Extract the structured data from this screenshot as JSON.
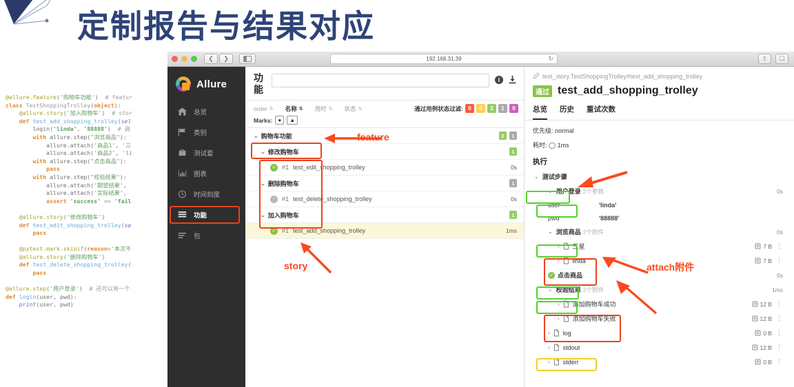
{
  "slide": {
    "title": "定制报告与结果对应"
  },
  "code": {
    "lines": [
      "@allure.feature('购物车功能')  # featur",
      "class TestShoppingTrolley(object):",
      "    @allure.story('加入购物车')  # stor",
      "    def test_add_shopping_trolley(sel",
      "        login('linda', '88888')  # 调",
      "        with allure.step(\"浏览商品\"):",
      "            allure.attach('商品1', '三",
      "            allure.attach('商品2', 'li",
      "        with allure.step(\"点击商品\"):",
      "            pass",
      "        with allure.step(\"校验结果\"):",
      "            allure.attach('期望结果',",
      "            allure.attach('实际结果',",
      "            assert 'success' == 'fail",
      "",
      "    @allure.story('修改购物车')",
      "    def test_edit_shopping_trolley(se",
      "        pass",
      "",
      "    @pytest.mark.skipif(reason='本次不",
      "    @allure.story('删除购物车')",
      "    def test_delete_shopping_trolley(",
      "        pass",
      "",
      "@allure.step('用户登录')  # 还可以将一个",
      "def login(user, pwd):",
      "    print(user, pwd)"
    ]
  },
  "browser": {
    "url": "192.168.31.39",
    "back_icon": "chevron-left-icon",
    "forward_icon": "chevron-right-icon",
    "sidebar_toggle_icon": "sidebar-toggle-icon",
    "reload_icon": "reload-icon",
    "share_icon": "share-icon",
    "tabs_icon": "new-tab-icon"
  },
  "allure_nav": {
    "brand": "Allure",
    "items": [
      {
        "label": "总览",
        "icon": "home-icon",
        "active": false
      },
      {
        "label": "类别",
        "icon": "flag-icon",
        "active": false
      },
      {
        "label": "测试套",
        "icon": "briefcase-icon",
        "active": false
      },
      {
        "label": "图表",
        "icon": "bar-chart-icon",
        "active": false
      },
      {
        "label": "时间刻度",
        "icon": "clock-icon",
        "active": false
      },
      {
        "label": "功能",
        "icon": "list-icon",
        "active": true
      },
      {
        "label": "包",
        "icon": "lines-icon",
        "active": false
      }
    ]
  },
  "mid_panel": {
    "title": "功能",
    "search_placeholder": "",
    "search_value": "",
    "info_icon": "info-icon",
    "download_icon": "download-icon",
    "sort_columns": [
      {
        "label": "order",
        "bold": false
      },
      {
        "label": "名称",
        "bold": true
      },
      {
        "label": "用时",
        "bold": false
      },
      {
        "label": "状态",
        "bold": false
      }
    ],
    "filter_label": "通过用例状态过滤:",
    "filter_badges": [
      {
        "value": "0",
        "color": "#fd5a3e"
      },
      {
        "value": "0",
        "color": "#ffd050"
      },
      {
        "value": "2",
        "color": "#97cc64"
      },
      {
        "value": "1",
        "color": "#aaaaaa"
      },
      {
        "value": "0",
        "color": "#d35ebe"
      }
    ],
    "marks_label": "Marks:",
    "marks": [
      "bug-icon",
      "warning-icon"
    ],
    "tree": [
      {
        "level": "feature",
        "label": "购物车功能",
        "chevron": "⌄",
        "badges": [
          {
            "value": "2",
            "color": "#97cc64"
          },
          {
            "value": "1",
            "color": "#aaaaaa"
          }
        ],
        "duration": ""
      },
      {
        "level": "story",
        "label": "修改购物车",
        "chevron": "⌄",
        "badges": [
          {
            "value": "1",
            "color": "#97cc64"
          }
        ],
        "duration": ""
      },
      {
        "level": "case",
        "label": "test_edit_shopping_trolley",
        "num": "#1",
        "status": "pass",
        "duration": "0s",
        "badges": []
      },
      {
        "level": "story",
        "label": "删除购物车",
        "chevron": "⌄",
        "badges": [
          {
            "value": "1",
            "color": "#aaaaaa"
          }
        ],
        "duration": ""
      },
      {
        "level": "case",
        "label": "test_delete_shopping_trolley",
        "num": "#1",
        "status": "skip",
        "duration": "0s",
        "badges": []
      },
      {
        "level": "story",
        "label": "加入购物车",
        "chevron": "⌄",
        "badges": [
          {
            "value": "1",
            "color": "#97cc64"
          }
        ],
        "duration": ""
      },
      {
        "level": "case",
        "label": "test_add_shopping_trolley",
        "num": "#1",
        "status": "pass",
        "duration": "1ms",
        "selected": true,
        "badges": []
      }
    ]
  },
  "right_panel": {
    "breadcrumb": "test_story.TestShoppingTrolley#test_add_shopping_trolley",
    "status_chip": "通过",
    "title": "test_add_shopping_trolley",
    "tabs": [
      {
        "label": "总览",
        "active": true
      },
      {
        "label": "历史",
        "active": false
      },
      {
        "label": "重试次数",
        "active": false
      }
    ],
    "severity_label": "优先级:",
    "severity_value": "normal",
    "duration_label": "耗时:",
    "duration_value": "1ms",
    "execution_label": "执行",
    "steps_label": "测试步骤",
    "steps": [
      {
        "name": "用户登录",
        "count": "2个参数",
        "level": 2,
        "chevron": "⌄",
        "duration": "0s",
        "highlight": "green",
        "params": [
          {
            "key": "user",
            "value": "'linda'"
          },
          {
            "key": "pwd",
            "value": "'88888'"
          }
        ],
        "attachments": []
      },
      {
        "name": "浏览商品",
        "count": "2个附件",
        "level": 2,
        "chevron": "⌄",
        "duration": "0s",
        "highlight": "green",
        "params": [],
        "attachments": [
          {
            "name": "三星",
            "size": "7 B"
          },
          {
            "name": "linda",
            "size": "7 B"
          }
        ]
      },
      {
        "name": "点击商品",
        "count": "",
        "level": 2,
        "chevron": "check",
        "duration": "0s",
        "highlight": "green",
        "params": [],
        "attachments": []
      },
      {
        "name": "校验结果",
        "count": "2个附件",
        "level": 2,
        "chevron": "⌄",
        "duration": "1ms",
        "highlight": "green",
        "params": [],
        "attachments": [
          {
            "name": "添加购物车成功",
            "size": "12 B"
          },
          {
            "name": "添加购物车失败",
            "size": "12 B"
          }
        ]
      }
    ],
    "root_attachments": [
      {
        "name": "log",
        "size": "0 B",
        "highlight": ""
      },
      {
        "name": "stdout",
        "size": "12 B",
        "highlight": "yellow"
      },
      {
        "name": "stderr",
        "size": "0 B",
        "highlight": ""
      }
    ]
  },
  "annotations": [
    {
      "id": "feature",
      "text": "feature"
    },
    {
      "id": "story",
      "text": "story"
    },
    {
      "id": "attach",
      "text": "attach附件"
    }
  ]
}
